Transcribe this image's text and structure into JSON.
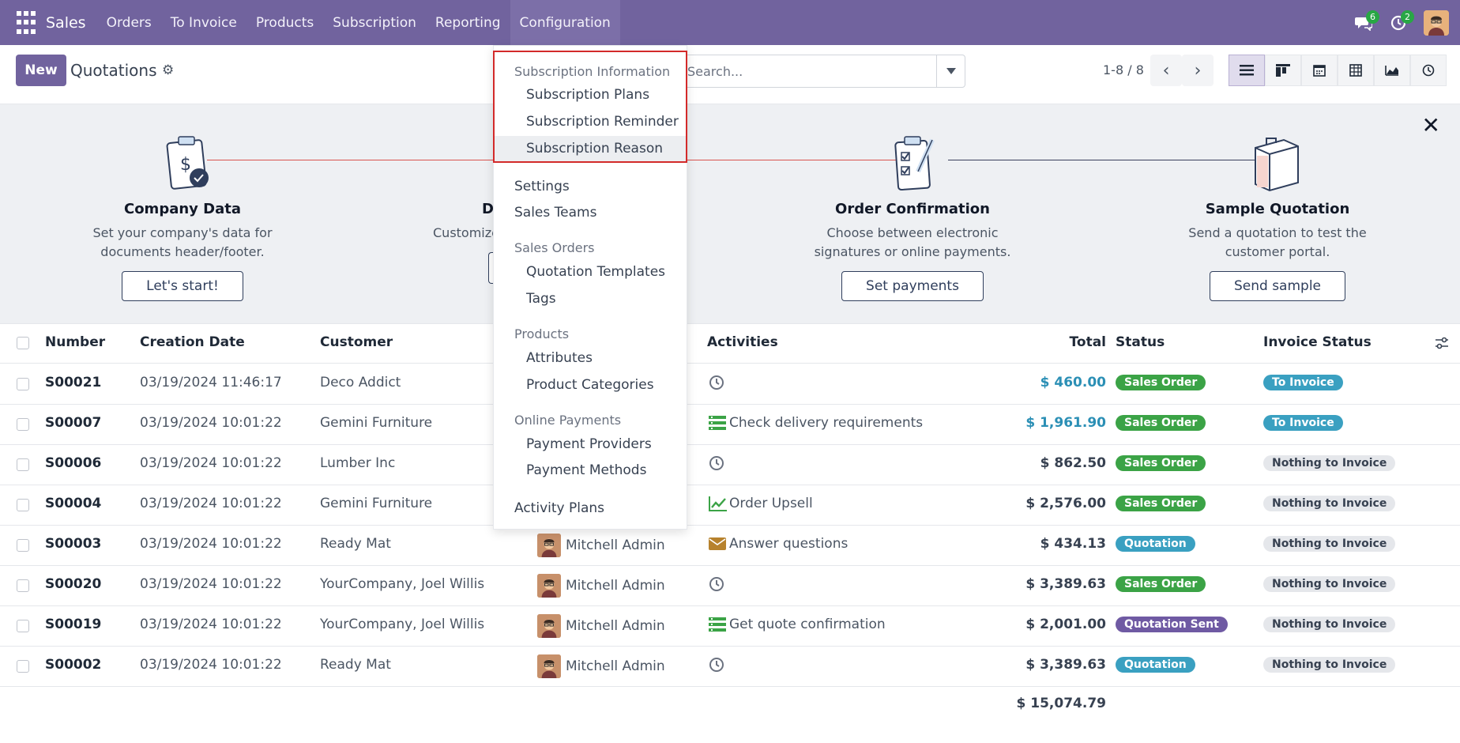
{
  "topbar": {
    "app_name": "Sales",
    "nav": [
      "Orders",
      "To Invoice",
      "Products",
      "Subscription",
      "Reporting",
      "Configuration"
    ],
    "messages_count": "6",
    "activities_count": "2"
  },
  "control": {
    "new_label": "New",
    "title": "Quotations",
    "search_placeholder": "Search...",
    "pager": "1-8 / 8"
  },
  "banner": {
    "steps": [
      {
        "title": "Company Data",
        "desc": "Set your company's data for documents header/footer.",
        "button": "Let's start!"
      },
      {
        "title": "D",
        "desc": "Customize",
        "button": ""
      },
      {
        "title": "Order Confirmation",
        "desc": "Choose between electronic signatures or online payments.",
        "button": "Set payments"
      },
      {
        "title": "Sample Quotation",
        "desc": "Send a quotation to test the customer portal.",
        "button": "Send sample"
      }
    ]
  },
  "table": {
    "headers": [
      "Number",
      "Creation Date",
      "Customer",
      "Activities",
      "Total",
      "Status",
      "Invoice Status"
    ],
    "rows": [
      {
        "number": "S00021",
        "date": "03/19/2024 11:46:17",
        "customer": "Deco Addict",
        "salesperson": "",
        "activity": "",
        "activity_icon": "clock-icon",
        "total": "$ 460.00",
        "total_color": "#2b8fb5",
        "status": "Sales Order",
        "invoice": "To Invoice"
      },
      {
        "number": "S00007",
        "date": "03/19/2024 10:01:22",
        "customer": "Gemini Furniture",
        "salesperson": "",
        "activity": "Check delivery requirements",
        "activity_icon": "list-icon",
        "total": "$ 1,961.90",
        "total_color": "#2b8fb5",
        "status": "Sales Order",
        "invoice": "To Invoice"
      },
      {
        "number": "S00006",
        "date": "03/19/2024 10:01:22",
        "customer": "Lumber Inc",
        "salesperson": "",
        "activity": "",
        "activity_icon": "clock-icon",
        "total": "$ 862.50",
        "total_color": "#374151",
        "status": "Sales Order",
        "invoice": "Nothing to Invoice"
      },
      {
        "number": "S00004",
        "date": "03/19/2024 10:01:22",
        "customer": "Gemini Furniture",
        "salesperson": "",
        "activity": "Order Upsell",
        "activity_icon": "chart-icon",
        "total": "$ 2,576.00",
        "total_color": "#374151",
        "status": "Sales Order",
        "invoice": "Nothing to Invoice"
      },
      {
        "number": "S00003",
        "date": "03/19/2024 10:01:22",
        "customer": "Ready Mat",
        "salesperson": "Mitchell Admin",
        "activity": "Answer questions",
        "activity_icon": "envelope-icon",
        "total": "$ 434.13",
        "total_color": "#374151",
        "status": "Quotation",
        "invoice": "Nothing to Invoice"
      },
      {
        "number": "S00020",
        "date": "03/19/2024 10:01:22",
        "customer": "YourCompany, Joel Willis",
        "salesperson": "Mitchell Admin",
        "activity": "",
        "activity_icon": "clock-icon",
        "total": "$ 3,389.63",
        "total_color": "#374151",
        "status": "Sales Order",
        "invoice": "Nothing to Invoice"
      },
      {
        "number": "S00019",
        "date": "03/19/2024 10:01:22",
        "customer": "YourCompany, Joel Willis",
        "salesperson": "Mitchell Admin",
        "activity": "Get quote confirmation",
        "activity_icon": "list-icon",
        "total": "$ 2,001.00",
        "total_color": "#374151",
        "status": "Quotation Sent",
        "invoice": "Nothing to Invoice"
      },
      {
        "number": "S00002",
        "date": "03/19/2024 10:01:22",
        "customer": "Ready Mat",
        "salesperson": "Mitchell Admin",
        "activity": "",
        "activity_icon": "clock-icon",
        "total": "$ 3,389.63",
        "total_color": "#374151",
        "status": "Quotation",
        "invoice": "Nothing to Invoice"
      }
    ],
    "grand_total": "$ 15,074.79"
  },
  "menu": {
    "subscription_section": "Subscription Information",
    "subscription_items": [
      "Subscription Plans",
      "Subscription Reminder",
      "Subscription Reason"
    ],
    "settings": "Settings",
    "sales_teams": "Sales Teams",
    "sales_orders_section": "Sales Orders",
    "sales_orders_items": [
      "Quotation Templates",
      "Tags"
    ],
    "products_section": "Products",
    "products_items": [
      "Attributes",
      "Product Categories"
    ],
    "payments_section": "Online Payments",
    "payments_items": [
      "Payment Providers",
      "Payment Methods"
    ],
    "activity_plans": "Activity Plans"
  }
}
